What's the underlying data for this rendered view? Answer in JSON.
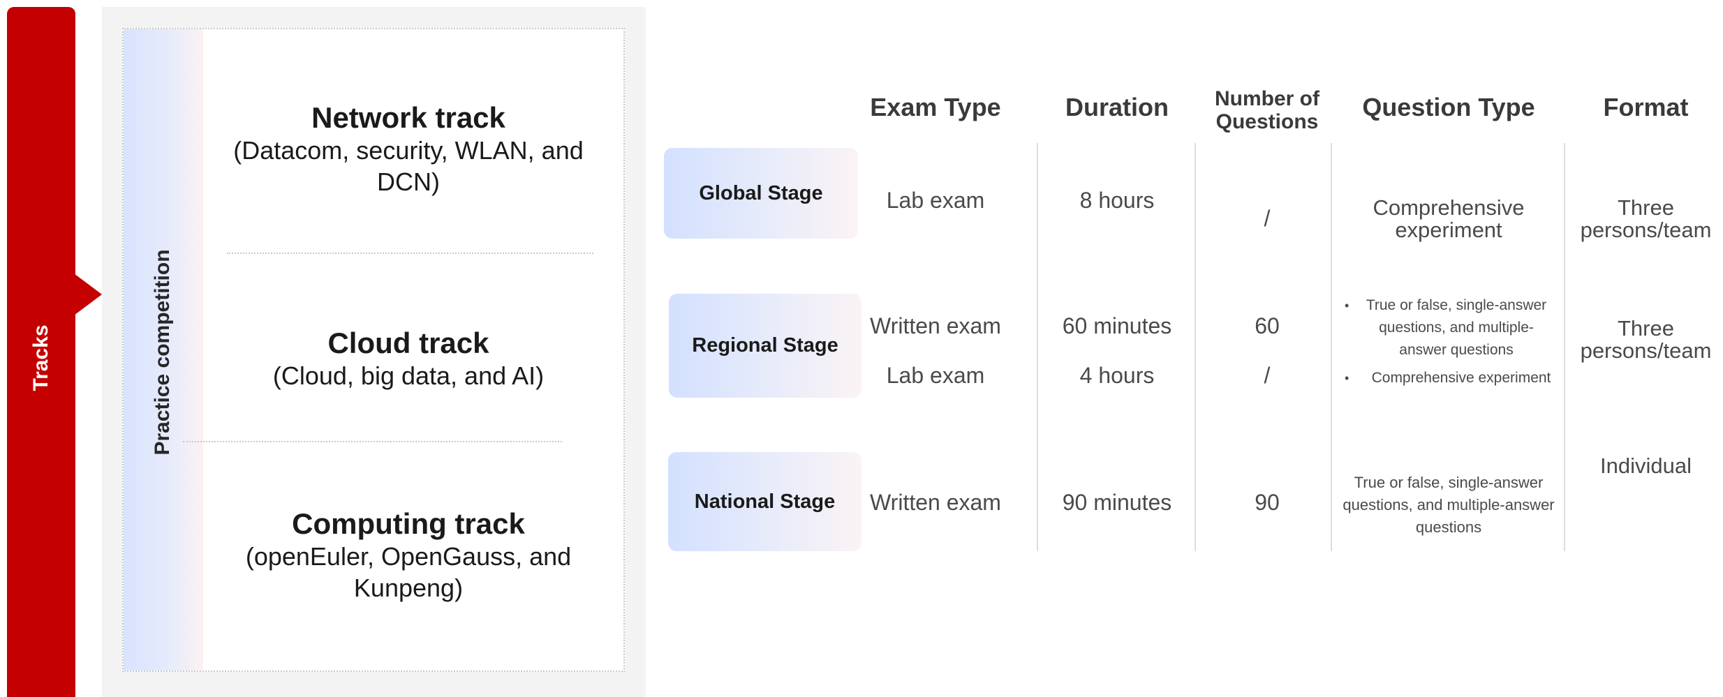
{
  "sidebar": {
    "tracks_label": "Tracks"
  },
  "left_panel": {
    "practice_label": "Practice competition",
    "tracks": [
      {
        "name": "Network track",
        "desc": "(Datacom, security, WLAN, and DCN)"
      },
      {
        "name": "Cloud track",
        "desc": "(Cloud, big data, and AI)"
      },
      {
        "name": "Computing track",
        "desc": "(openEuler, OpenGauss, and Kunpeng)"
      }
    ]
  },
  "table": {
    "headers": [
      "Exam Type",
      "Duration",
      "Number of Questions",
      "Question Type",
      "Format"
    ],
    "stages": [
      {
        "name": "Global Stage",
        "exam_type": "Lab exam",
        "duration": "8 hours",
        "questions": "/",
        "question_type": "Comprehensive experiment",
        "format": "Three persons/team"
      },
      {
        "name": "Regional Stage",
        "exam_type_1": "Written exam",
        "duration_1": "60 minutes",
        "questions_1": "60",
        "exam_type_2": "Lab exam",
        "duration_2": "4 hours",
        "questions_2": "/",
        "question_type_items": [
          "True or false, single-answer questions, and multiple-answer questions",
          "Comprehensive experiment"
        ],
        "format": "Three persons/team"
      },
      {
        "name": "National Stage",
        "exam_type": "Written exam",
        "duration": "90 minutes",
        "questions": "90",
        "question_type": "True or false, single-answer questions, and multiple-answer questions",
        "format": "Individual"
      }
    ]
  },
  "colors": {
    "accent_red": "#c40000",
    "panel_gray": "#f3f3f3",
    "text_gray": "#4a4a4a"
  }
}
